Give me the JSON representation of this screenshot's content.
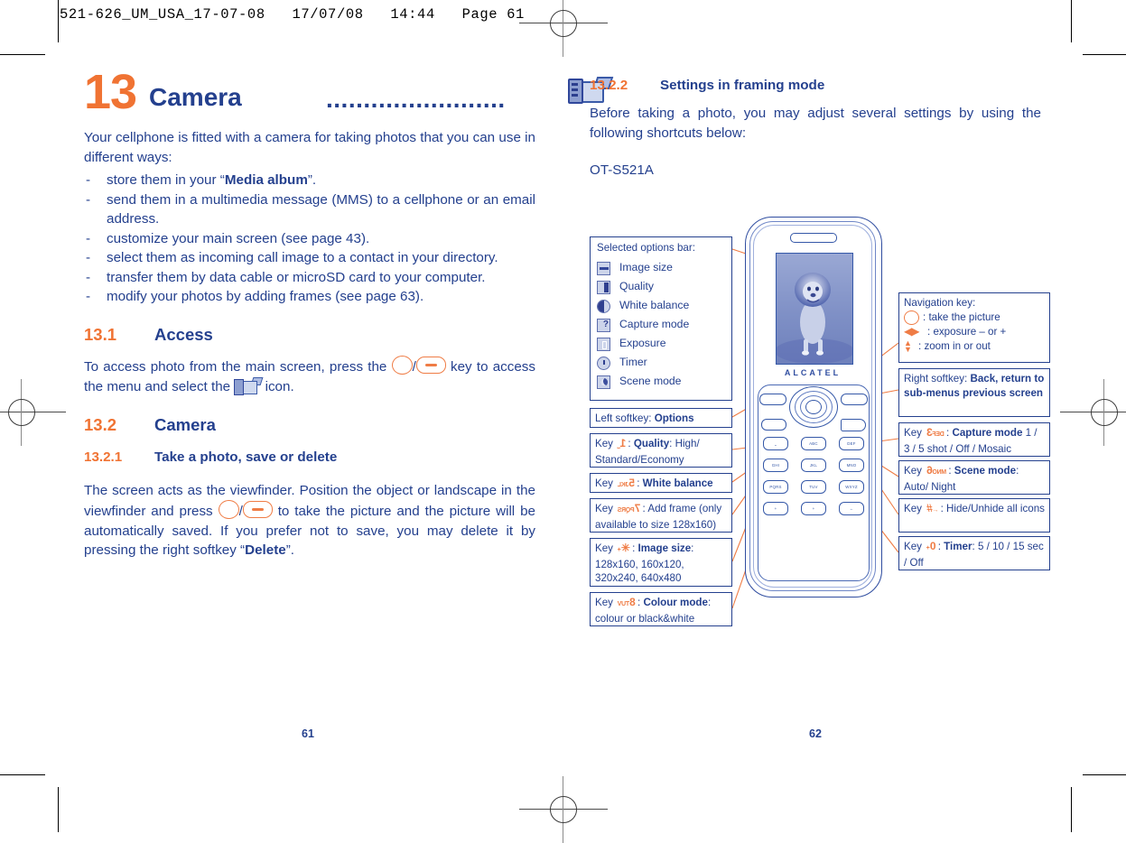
{
  "print_header": "521-626_UM_USA_17-07-08   17/07/08   14:44   Page 61",
  "colors": {
    "orange": "#f07333",
    "blue": "#24408e",
    "callout_line": "#ef7c45"
  },
  "left_page": {
    "chapter": {
      "number": "13",
      "title": "Camera",
      "dots": "........................",
      "icon": "camcorder-icon"
    },
    "intro": "Your cellphone is fitted with a camera for taking photos that you can use in different ways:",
    "bullets": [
      {
        "pre": "store them in your “",
        "bold": "Media album",
        "post": "”."
      },
      {
        "pre": "send them in a multimedia message (MMS) to a cellphone or an email address.",
        "bold": "",
        "post": ""
      },
      {
        "pre": "customize your main screen (see page 43).",
        "bold": "",
        "post": ""
      },
      {
        "pre": "select them as incoming call image to a contact in your directory.",
        "bold": "",
        "post": ""
      },
      {
        "pre": "transfer them by data cable or microSD card to your computer.",
        "bold": "",
        "post": ""
      },
      {
        "pre": "modify your photos by adding frames (see page 63).",
        "bold": "",
        "post": ""
      }
    ],
    "section_access": {
      "num": "13.1",
      "title": "Access"
    },
    "access_text_1": "To access photo from the main screen, press the",
    "access_text_2": "/",
    "access_text_3": "key to access the menu and select the",
    "access_text_4": "icon.",
    "section_camera": {
      "num": "13.2",
      "title": "Camera"
    },
    "subsection_take": {
      "num": "13.2.1",
      "title": "Take a photo, save or delete"
    },
    "take_text_1": "The screen acts as the viewfinder. Position the object or landscape in the viewfinder and press",
    "take_text_2": "/",
    "take_text_3": "to take the picture and the picture will be automatically saved. If you prefer not to save, you may delete it by pressing the right softkey “",
    "take_text_bold": "Delete",
    "take_text_4": "”.",
    "page_number": "61"
  },
  "right_page": {
    "subsection_settings": {
      "num": "13.2.2",
      "title": "Settings in framing mode"
    },
    "settings_intro": "Before taking a photo, you may adjust several settings by using the following shortcuts below:",
    "model": "OT-S521A",
    "page_number": "62",
    "diagram": {
      "options_bar": {
        "heading": "Selected options bar:",
        "items": [
          {
            "icon": "image-size-icon",
            "label": "Image size"
          },
          {
            "icon": "quality-icon",
            "label": "Quality"
          },
          {
            "icon": "white-balance-icon",
            "label": "White balance"
          },
          {
            "icon": "capture-mode-icon",
            "label": "Capture mode"
          },
          {
            "icon": "exposure-icon",
            "label": "Exposure"
          },
          {
            "icon": "timer-icon",
            "label": "Timer"
          },
          {
            "icon": "scene-mode-icon",
            "label": "Scene mode"
          }
        ]
      },
      "left_callouts": [
        {
          "prefix": "Left softkey: ",
          "bold": "Options",
          "suffix": "",
          "key": ""
        },
        {
          "prefix": "Key ",
          "key": "1",
          "keysub": "⎵",
          "bold": "Quality",
          "suffix": ": High/ Standard/Economy"
        },
        {
          "prefix": "Key ",
          "key": "5",
          "keysub": "JKL",
          "bold": "White balance",
          "suffix": ""
        },
        {
          "prefix": "Key ",
          "key": "7",
          "keysub": "PQRS",
          "bold": "",
          "suffix": ": Add frame (only available to size 128x160)"
        },
        {
          "prefix": "Key ",
          "key": "✳",
          "keysub": "+",
          "bold": "Image size",
          "suffix": ": 128x160, 160x120, 320x240, 640x480"
        },
        {
          "prefix": "Key ",
          "key": "8",
          "keysub": "TUV",
          "bold": "Colour mode",
          "suffix": ": colour or black&white"
        }
      ],
      "nav_callout": {
        "heading": "Navigation key:",
        "rows": [
          {
            "icon": "circle-key-icon",
            "text": ": take the picture"
          },
          {
            "icon": "left-right-arrows-icon",
            "text": ": exposure – or +"
          },
          {
            "icon": "up-down-arrows-icon",
            "text": ": zoom in or out"
          }
        ]
      },
      "right_callouts": [
        {
          "prefix": "Right softkey: ",
          "bold": "Back, return to sub-menus previous screen",
          "suffix": "",
          "key": ""
        },
        {
          "prefix": "Key ",
          "key": "3",
          "keysub": "DEF",
          "bold": "Capture mode",
          "suffix": " 1 / 3 / 5 shot / Off / Mosaic"
        },
        {
          "prefix": "Key ",
          "key": "6",
          "keysub": "MNO",
          "bold": "Scene mode",
          "suffix": ": Auto/ Night"
        },
        {
          "prefix": "Key ",
          "key": "#",
          "keysub": "←",
          "bold": "",
          "suffix": ": Hide/Unhide all icons"
        },
        {
          "prefix": "Key ",
          "key": "0",
          "keysub": "+",
          "bold": "Timer",
          "suffix": ": 5 / 10 / 15 sec / Off"
        }
      ],
      "phone": {
        "brand": "ALCATEL",
        "screen_image": "lion-photo",
        "keys": [
          {
            "digit": "1",
            "letters": "⎵"
          },
          {
            "digit": "2",
            "letters": "ABC"
          },
          {
            "digit": "3",
            "letters": "DEF"
          },
          {
            "digit": "4",
            "letters": "GHI"
          },
          {
            "digit": "5",
            "letters": "JKL"
          },
          {
            "digit": "6",
            "letters": "MNO"
          },
          {
            "digit": "7",
            "letters": "PQRS"
          },
          {
            "digit": "8",
            "letters": "TUV"
          },
          {
            "digit": "9",
            "letters": "WXYZ"
          },
          {
            "digit": "*",
            "letters": "+"
          },
          {
            "digit": "0",
            "letters": "+"
          },
          {
            "digit": "#",
            "letters": "←"
          }
        ]
      }
    }
  }
}
